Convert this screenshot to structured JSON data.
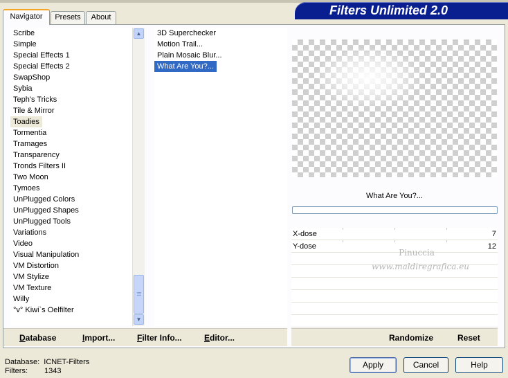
{
  "window": {
    "brand": "Filters Unlimited 2.0"
  },
  "tabs": [
    {
      "label": "Navigator",
      "active": true
    },
    {
      "label": "Presets",
      "active": false
    },
    {
      "label": "About",
      "active": false
    }
  ],
  "categories": [
    "Scribe",
    "Simple",
    "Special Effects 1",
    "Special Effects 2",
    "SwapShop",
    "Sybia",
    "Teph's Tricks",
    "Tile & Mirror",
    "Toadies",
    "Tormentia",
    "Tramages",
    "Transparency",
    "Tronds Filters II",
    "Two Moon",
    "Tymoes",
    "UnPlugged Colors",
    "UnPlugged Shapes",
    "UnPlugged Tools",
    "Variations",
    "Video",
    "Visual Manipulation",
    "VM Distortion",
    "VM Stylize",
    "VM Texture",
    "Willy",
    "°v° Kiwi`s Oelfilter"
  ],
  "selected_category": "Toadies",
  "filters": [
    "3D Superchecker",
    "Motion Trail...",
    "Plain Mosaic Blur...",
    "What Are You?..."
  ],
  "selected_filter": "What Are You?...",
  "preview": {
    "filter_name": "What Are You?...",
    "progress": 0
  },
  "parameters": [
    {
      "label": "X-dose",
      "value": "7"
    },
    {
      "label": "Y-dose",
      "value": "12"
    }
  ],
  "watermark": {
    "line1": "Pinuccia",
    "line2": "www.maldiregrafica.eu"
  },
  "left_buttons": [
    {
      "first": "D",
      "rest": "atabase"
    },
    {
      "first": "I",
      "rest": "mport..."
    },
    {
      "first": "F",
      "rest": "ilter Info..."
    },
    {
      "first": "E",
      "rest": "ditor..."
    }
  ],
  "right_buttons": {
    "randomize": "Randomize",
    "reset": "Reset"
  },
  "status": {
    "database_label": "Database:",
    "database_value": "ICNET-Filters",
    "filters_label": "Filters:",
    "filters_value": "1343"
  },
  "dialog_buttons": {
    "apply": "Apply",
    "cancel": "Cancel",
    "help": "Help"
  },
  "colors": {
    "brand_bg": "#0a1f8f",
    "selection": "#316ac5",
    "tab_accent": "#f5a623"
  }
}
